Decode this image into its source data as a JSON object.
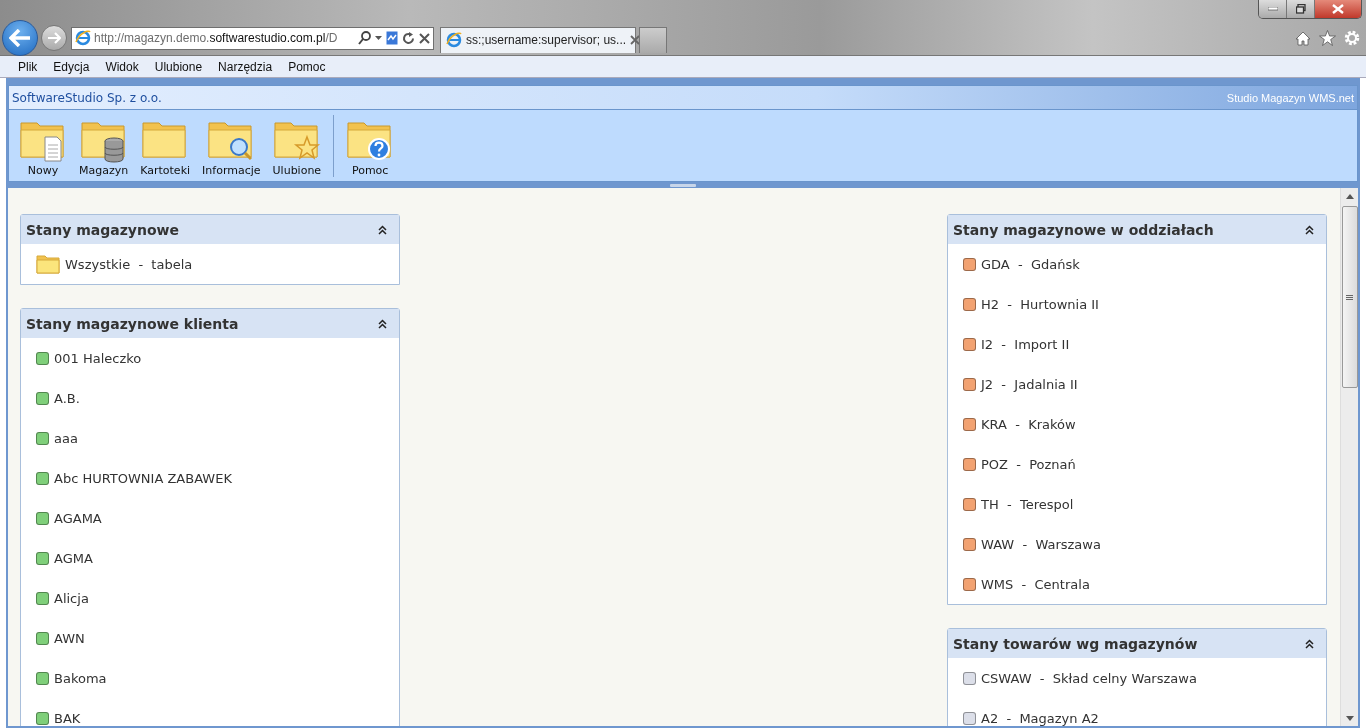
{
  "browser": {
    "address": {
      "prefix": "http://magazyn.demo.",
      "domain": "softwarestudio.com.pl",
      "path": "/D"
    },
    "tabs": [
      {
        "title": "ss:;username:supervisor; us...",
        "selected": true
      }
    ],
    "menu": [
      "Plik",
      "Edycja",
      "Widok",
      "Ulubione",
      "Narzędzia",
      "Pomoc"
    ]
  },
  "app": {
    "company": "SoftwareStudio Sp. z o.o.",
    "product": "Studio Magazyn WMS.net",
    "toolbar": [
      {
        "label": "Nowy",
        "kind": "document",
        "separator_before": false
      },
      {
        "label": "Magazyn",
        "kind": "database",
        "separator_before": false
      },
      {
        "label": "Kartoteki",
        "kind": "plain",
        "separator_before": false
      },
      {
        "label": "Informacje",
        "kind": "search",
        "separator_before": false
      },
      {
        "label": "Ulubione",
        "kind": "star",
        "separator_before": false
      },
      {
        "label": "Pomoc",
        "kind": "help",
        "separator_before": true
      }
    ],
    "columns": [
      [
        {
          "title": "Stany magazynowe",
          "expanded": true,
          "items": [
            {
              "label": "Wszystkie  -  tabela",
              "kind": "folder"
            }
          ]
        },
        {
          "title": "Stany magazynowe klienta",
          "expanded": true,
          "items": [
            {
              "label": "001 Haleczko",
              "kind": "square",
              "color": "#7fcf7a"
            },
            {
              "label": "A.B.",
              "kind": "square",
              "color": "#7fcf7a"
            },
            {
              "label": "aaa",
              "kind": "square",
              "color": "#7fcf7a"
            },
            {
              "label": "Abc HURTOWNIA ZABAWEK",
              "kind": "square",
              "color": "#7fcf7a"
            },
            {
              "label": "AGAMA",
              "kind": "square",
              "color": "#7fcf7a"
            },
            {
              "label": "AGMA",
              "kind": "square",
              "color": "#7fcf7a"
            },
            {
              "label": "Alicja",
              "kind": "square",
              "color": "#7fcf7a"
            },
            {
              "label": "AWN",
              "kind": "square",
              "color": "#7fcf7a"
            },
            {
              "label": "Bakoma",
              "kind": "square",
              "color": "#7fcf7a"
            },
            {
              "label": "BAK",
              "kind": "square",
              "color": "#7fcf7a"
            }
          ]
        }
      ],
      [
        {
          "title": "Stany magazynowe w oddziałach",
          "expanded": true,
          "items": [
            {
              "label": "GDA  -  Gdańsk",
              "kind": "square",
              "color": "#f2a271"
            },
            {
              "label": "H2  -  Hurtownia II",
              "kind": "square",
              "color": "#f2a271"
            },
            {
              "label": "I2  -  Import II",
              "kind": "square",
              "color": "#f2a271"
            },
            {
              "label": "J2  -  Jadalnia II",
              "kind": "square",
              "color": "#f2a271"
            },
            {
              "label": "KRA  -  Kraków",
              "kind": "square",
              "color": "#f2a271"
            },
            {
              "label": "POZ  -  Poznań",
              "kind": "square",
              "color": "#f2a271"
            },
            {
              "label": "TH  -  Terespol",
              "kind": "square",
              "color": "#f2a271"
            },
            {
              "label": "WAW  -  Warszawa",
              "kind": "square",
              "color": "#f2a271"
            },
            {
              "label": "WMS  -  Centrala",
              "kind": "square",
              "color": "#f2a271"
            }
          ]
        },
        {
          "title": "Stany towarów wg magazynów",
          "expanded": true,
          "items": [
            {
              "label": "CSWAW  -  Skład celny Warszawa",
              "kind": "square",
              "color": "#dcdfe9"
            },
            {
              "label": "A2  -  Magazyn A2",
              "kind": "square",
              "color": "#dcdfe9"
            }
          ]
        }
      ]
    ]
  }
}
